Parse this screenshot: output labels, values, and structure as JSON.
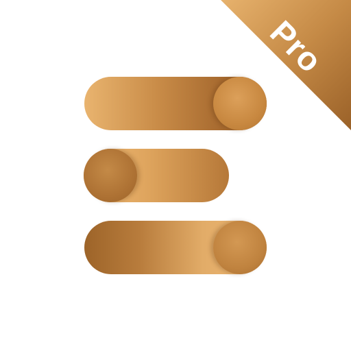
{
  "app_icon": {
    "name": "toggle-settings-pro-app-icon",
    "badge": {
      "text": "Pro"
    },
    "toggles": [
      {
        "state": "on"
      },
      {
        "state": "off"
      },
      {
        "state": "on"
      }
    ],
    "colors": {
      "background": "#ffffff",
      "gold_light": "#f0ba76",
      "gold_mid": "#c98c48",
      "gold_dark": "#9d6429",
      "badge_text": "#ffffff"
    }
  }
}
